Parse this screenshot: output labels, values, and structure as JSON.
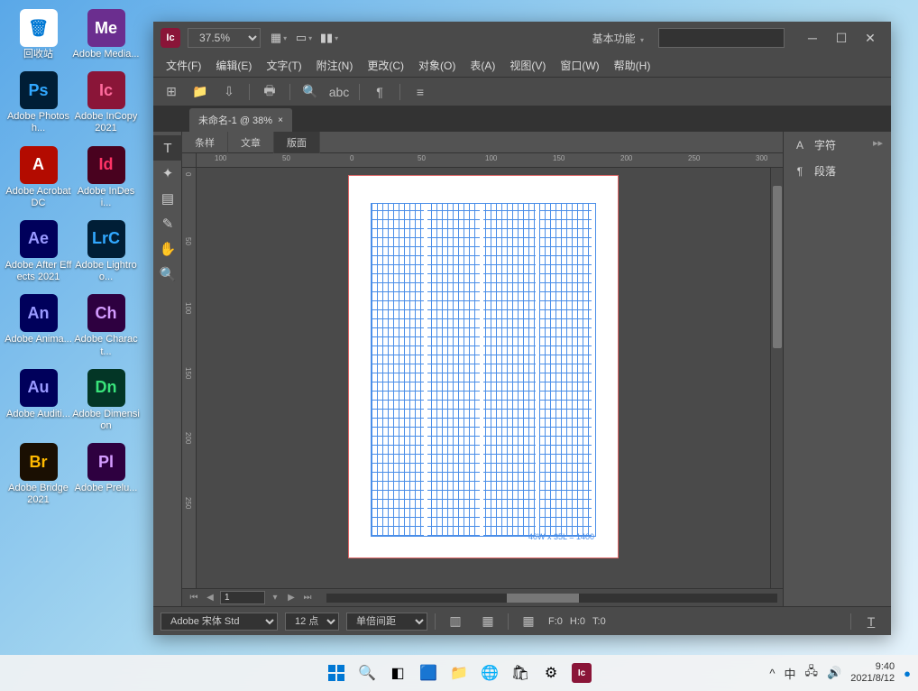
{
  "desktop": {
    "icons": [
      {
        "label": "回收站",
        "bg": "#ffffff",
        "text": "🗑",
        "fg": "#0078d4"
      },
      {
        "label": "Adobe Media...",
        "bg": "#6b2e8f",
        "text": "Me"
      },
      {
        "label": "Adobe Photosh...",
        "bg": "#001e36",
        "text": "Ps",
        "fg": "#31a8ff"
      },
      {
        "label": "Adobe InCopy 2021",
        "bg": "#8a1538",
        "text": "Ic",
        "fg": "#ff6b9d"
      },
      {
        "label": "Adobe Acrobat DC",
        "bg": "#b30b00",
        "text": "A"
      },
      {
        "label": "Adobe InDesi...",
        "bg": "#49021f",
        "text": "Id",
        "fg": "#ff3366"
      },
      {
        "label": "Adobe After Effects 2021",
        "bg": "#00005b",
        "text": "Ae",
        "fg": "#9999ff"
      },
      {
        "label": "Adobe Lightroo...",
        "bg": "#001e36",
        "text": "LrC",
        "fg": "#31a8ff"
      },
      {
        "label": "Adobe Anima...",
        "bg": "#00005b",
        "text": "An",
        "fg": "#9999ff"
      },
      {
        "label": "Adobe Charact...",
        "bg": "#2e0040",
        "text": "Ch",
        "fg": "#d49cff"
      },
      {
        "label": "Adobe Auditi...",
        "bg": "#00005b",
        "text": "Au",
        "fg": "#9999ff"
      },
      {
        "label": "Adobe Dimension",
        "bg": "#033626",
        "text": "Dn",
        "fg": "#39e47b"
      },
      {
        "label": "Adobe Bridge 2021",
        "bg": "#1a0f02",
        "text": "Br",
        "fg": "#ffba00"
      },
      {
        "label": "Adobe Prelu...",
        "bg": "#2e0040",
        "text": "Pl",
        "fg": "#d49cff"
      }
    ]
  },
  "app": {
    "icon_text": "Ic",
    "zoom": "37.5%",
    "workspace": "基本功能",
    "menus": [
      "文件(F)",
      "编辑(E)",
      "文字(T)",
      "附注(N)",
      "更改(C)",
      "对象(O)",
      "表(A)",
      "视图(V)",
      "窗口(W)",
      "帮助(H)"
    ],
    "doc_tab": "未命名-1 @ 38%",
    "sub_tabs": [
      "条样",
      "文章",
      "版面"
    ],
    "active_sub_tab": 2,
    "h_ruler_marks": [
      "100",
      "50",
      "0",
      "50",
      "100",
      "150",
      "200",
      "250",
      "300"
    ],
    "v_ruler_marks": [
      "0",
      "50",
      "100",
      "150",
      "200",
      "250"
    ],
    "grid_info": "40W x 35L = 1400",
    "page_num": "1",
    "panels": [
      {
        "icon": "A",
        "label": "字符"
      },
      {
        "icon": "¶",
        "label": "段落"
      }
    ],
    "font": "Adobe 宋体 Std",
    "font_size": "12 点",
    "line_spacing": "单倍间距",
    "frame_props": {
      "f": "F:0",
      "h": "H:0",
      "t": "T:0"
    }
  },
  "taskbar": {
    "ime": "中",
    "time": "9:40",
    "date": "2021/8/12"
  }
}
